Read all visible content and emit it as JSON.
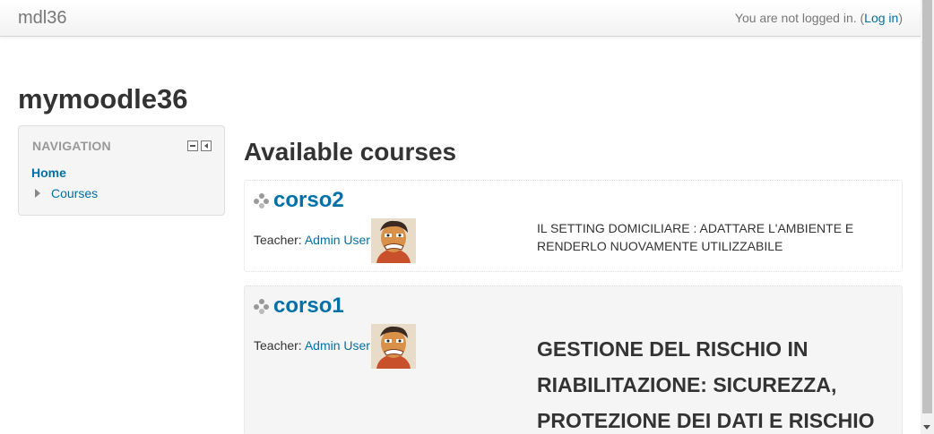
{
  "header": {
    "brand": "mdl36",
    "login_text": "You are not logged in. (",
    "login_link": "Log in",
    "login_close": ")"
  },
  "site_title": "mymoodle36",
  "navigation": {
    "header": "NAVIGATION",
    "home": "Home",
    "courses": "Courses"
  },
  "main": {
    "title": "Available courses",
    "courses": [
      {
        "name": "corso2",
        "teacher_label": "Teacher: ",
        "teacher_name": "Admin User",
        "summary": "IL SETTING DOMICILIARE : ADATTARE L'AMBIENTE E RENDERLO NUOVAMENTE UTILIZZABILE"
      },
      {
        "name": "corso1",
        "teacher_label": "Teacher: ",
        "teacher_name": "Admin User",
        "summary": "GESTIONE DEL RISCHIO IN RIABILITAZIONE: SICUREZZA, PROTEZIONE DEI DATI E RISCHIO"
      }
    ]
  },
  "colors": {
    "link": "#0070a8",
    "text": "#333333",
    "muted": "#777777",
    "block_bg": "#f5f5f5"
  },
  "icons": [
    "collapse-icon",
    "dock-icon",
    "expand-arrow-icon",
    "course-icon",
    "user-avatar"
  ]
}
